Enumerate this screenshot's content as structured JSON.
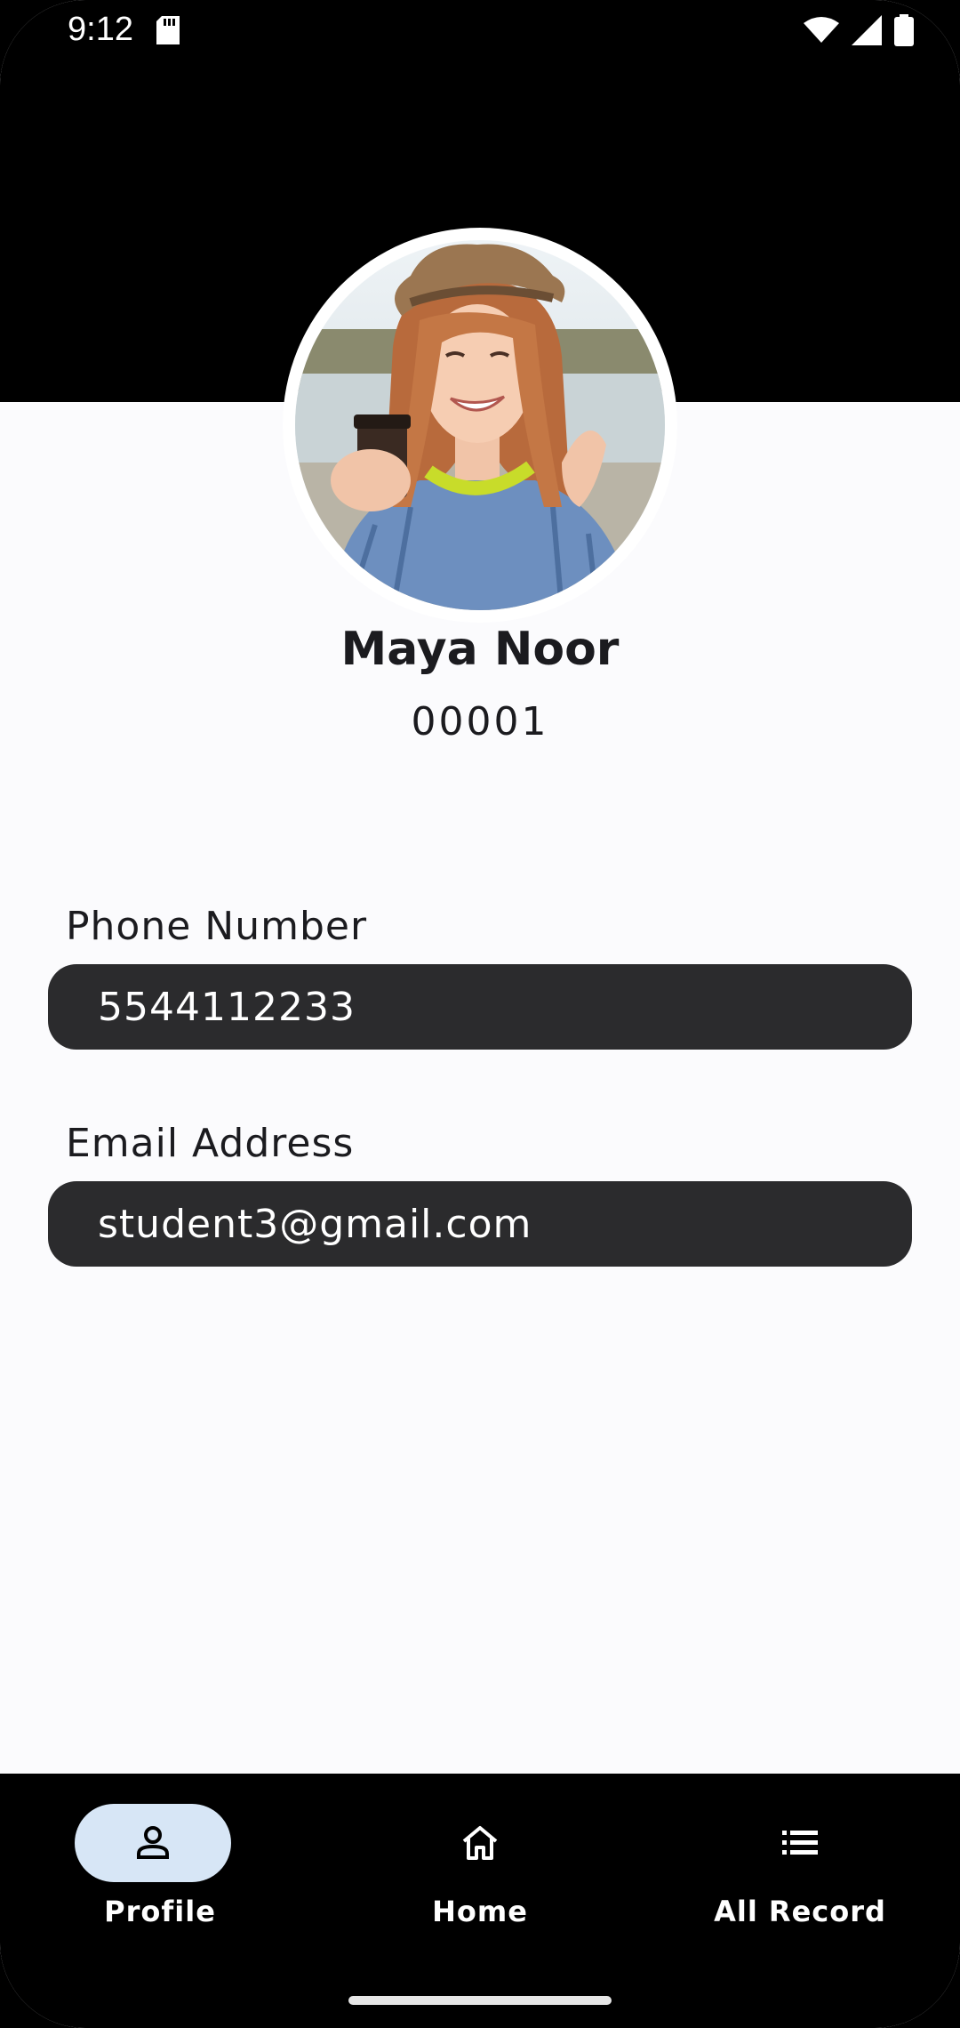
{
  "status_bar": {
    "time": "9:12",
    "icons": [
      "sd-card-icon",
      "wifi-icon",
      "signal-icon",
      "battery-icon"
    ]
  },
  "profile": {
    "name": "Maya Noor",
    "id": "00001",
    "avatar": "profile-photo"
  },
  "fields": {
    "phone": {
      "label": "Phone Number",
      "value": "5544112233"
    },
    "email": {
      "label": "Email Address",
      "value": "student3@gmail.com"
    }
  },
  "bottom_nav": {
    "items": [
      {
        "label": "Profile",
        "icon": "person-icon",
        "selected": true
      },
      {
        "label": "Home",
        "icon": "home-icon",
        "selected": false
      },
      {
        "label": "All Record",
        "icon": "list-icon",
        "selected": false
      }
    ]
  },
  "colors": {
    "header": "#000000",
    "background": "#fbfbfd",
    "field_fill": "#2b2b2d",
    "nav_pill": "#d7e6f6"
  }
}
